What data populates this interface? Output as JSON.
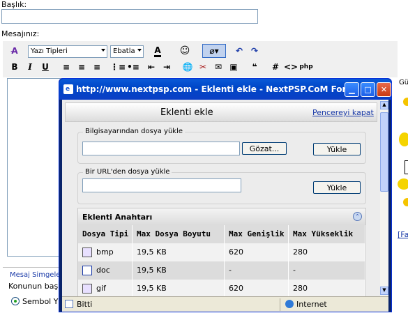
{
  "form": {
    "subject_label": "Başlık:",
    "message_label": "Mesajınız:",
    "font_select": "Yazı Tipleri",
    "size_select": "Ebatla",
    "bg_section_label": "Mesaj Simgeleri",
    "bg_row_text": "Konunun baş",
    "radio_label": "Sembol Y"
  },
  "sidepanel": {
    "label_top": "Gü",
    "link": "[Fa"
  },
  "popup": {
    "title": "http://www.nextpsp.com - Eklenti ekle - NextPSP.CoM For...",
    "heading": "Eklenti ekle",
    "close_link": "Pencereyi kapat",
    "upload_local_label": "Bilgisayarından dosya yükle",
    "browse_button": "Gözat...",
    "upload_button": "Yükle",
    "upload_url_label": "Bir URL'den dosya yükle",
    "upload_url_button": "Yükle",
    "keys_title": "Eklenti Anahtarı",
    "columns": [
      "Dosya Tipi",
      "Max Dosya Boyutu",
      "Max Genişlik",
      "Max Yükseklik"
    ],
    "rows": [
      {
        "type": "bmp",
        "size": "19,5 KB",
        "width": "620",
        "height": "280"
      },
      {
        "type": "doc",
        "size": "19,5 KB",
        "width": "-",
        "height": "-"
      },
      {
        "type": "gif",
        "size": "19,5 KB",
        "width": "620",
        "height": "280"
      }
    ],
    "status_text": "Bitti",
    "zone_text": "Internet"
  },
  "colors": {
    "title_blue": "#0047c8",
    "accent": "#0a246a"
  }
}
